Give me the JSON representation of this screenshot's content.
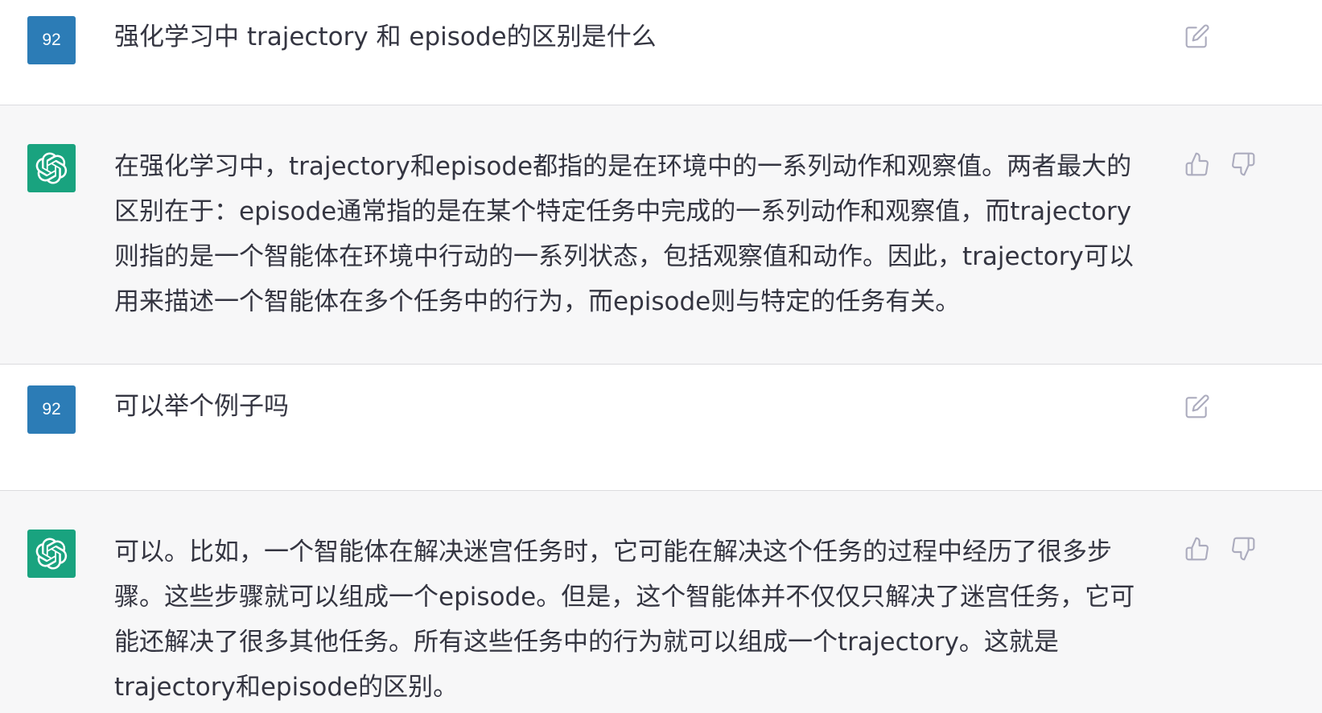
{
  "conversation": {
    "messages": [
      {
        "role": "user",
        "avatar_text": "92",
        "text": "强化学习中 trajectory 和 episode的区别是什么"
      },
      {
        "role": "assistant",
        "avatar_icon": "openai-logo-icon",
        "text": "在强化学习中，trajectory和episode都指的是在环境中的一系列动作和观察值。两者最大的\n区别在于：episode通常指的是在某个特定任务中完成的一系列动作和观察值，而trajectory\n则指的是一个智能体在环境中行动的一系列状态，包括观察值和动作。因此，trajectory可以\n用来描述一个智能体在多个任务中的行为，而episode则与特定的任务有关。"
      },
      {
        "role": "user",
        "avatar_text": "92",
        "text": "可以举个例子吗"
      },
      {
        "role": "assistant",
        "avatar_icon": "openai-logo-icon",
        "text": "可以。比如，一个智能体在解决迷宫任务时，它可能在解决这个任务的过程中经历了很多步\n骤。这些步骤就可以组成一个episode。但是，这个智能体并不仅仅只解决了迷宫任务，它可\n能还解决了很多其他任务。所有这些任务中的行为就可以组成一个trajectory。这就是\ntrajectory和episode的区别。"
      }
    ]
  },
  "colors": {
    "user_avatar": "#2c7cb6",
    "assistant_avatar": "#19a37f",
    "assistant_row_bg": "#f7f7f8",
    "text": "#343541",
    "icon": "#acacbe"
  },
  "icons": {
    "edit": "edit-icon",
    "like": "thumbs-up-icon",
    "dislike": "thumbs-down-icon"
  }
}
